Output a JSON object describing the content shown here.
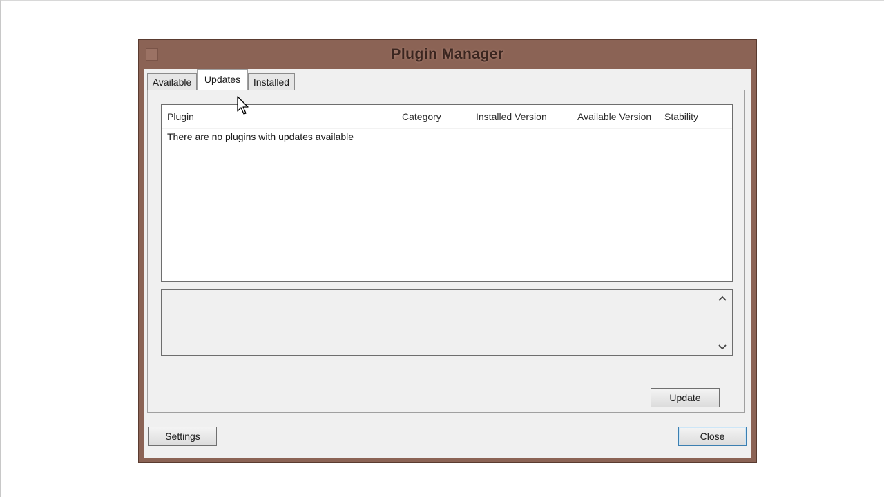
{
  "window": {
    "title": "Plugin Manager"
  },
  "tabs": [
    {
      "label": "Available",
      "selected": false
    },
    {
      "label": "Updates",
      "selected": true
    },
    {
      "label": "Installed",
      "selected": false
    }
  ],
  "list": {
    "columns": [
      "Plugin",
      "Category",
      "Installed Version",
      "Available Version",
      "Stability"
    ],
    "empty_message": "There are no plugins with updates available"
  },
  "buttons": {
    "update": "Update",
    "settings": "Settings",
    "close": "Close"
  },
  "colors": {
    "titlebar": "#8b6355",
    "client_background": "#f0f0f0",
    "focus_border": "#3c7fb1"
  },
  "icons": {
    "scroll_up": "chevron-up-icon",
    "scroll_down": "chevron-down-icon",
    "cursor": "mouse-pointer-icon"
  }
}
